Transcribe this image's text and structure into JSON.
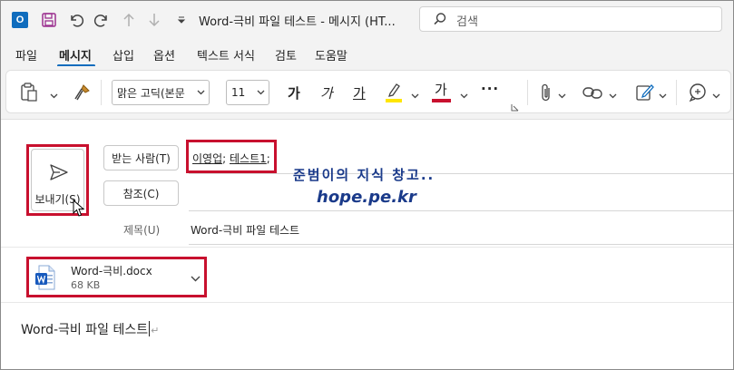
{
  "window": {
    "title": "Word-극비 파일 테스트  -  메시지 (HT...",
    "search_placeholder": "검색"
  },
  "menu": {
    "tabs": [
      {
        "label": "파일",
        "active": false
      },
      {
        "label": "메시지",
        "active": true
      },
      {
        "label": "삽입",
        "active": false
      },
      {
        "label": "옵션",
        "active": false
      },
      {
        "label": "텍스트 서식",
        "active": false
      },
      {
        "label": "검토",
        "active": false
      },
      {
        "label": "도움말",
        "active": false
      }
    ]
  },
  "ribbon": {
    "font_name": "맑은 고딕(본문",
    "font_size": "11",
    "bold_label": "가",
    "italic_label": "가",
    "underline_label": "가",
    "font_color_label": "가",
    "more_label": "···",
    "highlight_color": "#ffe600",
    "font_color": "#c8102e"
  },
  "compose": {
    "send_label": "보내기(S)",
    "to_button": "받는 사람(T)",
    "cc_button": "참조(C)",
    "subject_label": "제목(U)",
    "recipients": [
      "이영업",
      "테스트1"
    ],
    "separator": ";",
    "subject": "Word-극비 파일 테스트"
  },
  "watermark": {
    "line1": "준범이의 지식 창고..",
    "line2": "hope.pe.kr"
  },
  "attachment": {
    "name": "Word-극비.docx",
    "size": "68 KB"
  },
  "body": {
    "text": "Word-극비 파일 테스트",
    "para_mark": "↵"
  },
  "colors": {
    "accent": "#0f6cbd",
    "highlight_box": "#c8102e"
  }
}
